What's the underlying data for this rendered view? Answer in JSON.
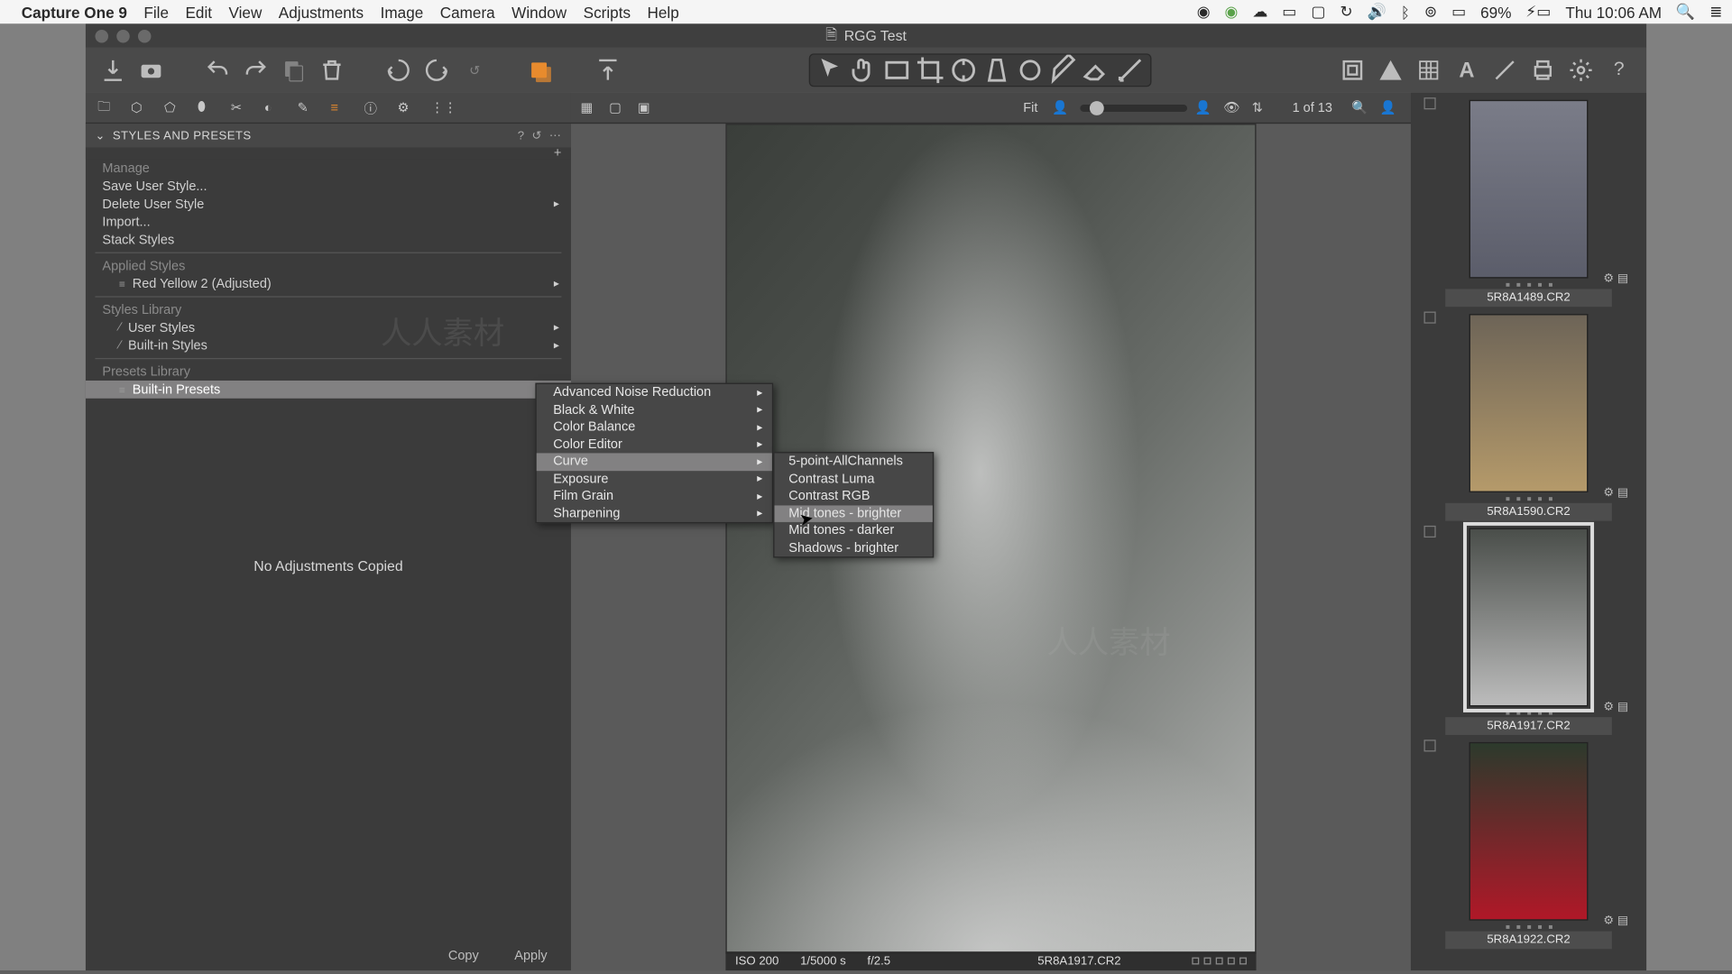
{
  "menubar": {
    "app": "Capture One 9",
    "items": [
      "File",
      "Edit",
      "View",
      "Adjustments",
      "Image",
      "Camera",
      "Window",
      "Scripts",
      "Help"
    ],
    "battery": "69%",
    "clock": "Thu 10:06 AM"
  },
  "window": {
    "title": "RGG Test"
  },
  "panel": {
    "title": "STYLES AND PRESETS",
    "manage": "Manage",
    "save_user_style": "Save User Style...",
    "delete_user_style": "Delete User Style",
    "import": "Import...",
    "stack_styles": "Stack Styles",
    "applied_styles": "Applied Styles",
    "applied_item": "Red Yellow 2 (Adjusted)",
    "styles_library": "Styles Library",
    "user_styles": "User Styles",
    "builtin_styles": "Built-in Styles",
    "presets_library": "Presets Library",
    "builtin_presets": "Built-in Presets",
    "no_adj": "No Adjustments Copied",
    "copy": "Copy",
    "apply": "Apply"
  },
  "flyout1": {
    "items": [
      "Advanced Noise Reduction",
      "Black & White",
      "Color Balance",
      "Color Editor",
      "Curve",
      "Exposure",
      "Film Grain",
      "Sharpening"
    ],
    "selected_index": 4
  },
  "flyout2": {
    "items": [
      "5-point-AllChannels",
      "Contrast Luma",
      "Contrast RGB",
      "Mid tones - brighter",
      "Mid tones - darker",
      "Shadows - brighter"
    ],
    "highlighted_index": 3
  },
  "viewer": {
    "fit": "Fit",
    "counter": "1 of 13",
    "iso": "ISO 200",
    "shutter": "1/5000 s",
    "aperture": "f/2.5",
    "filename": "5R8A1917.CR2"
  },
  "thumbs": [
    {
      "name": "5R8A1489.CR2",
      "sel": false,
      "grad": "linear-gradient(#7a7c88,#5b5d6a)"
    },
    {
      "name": "5R8A1590.CR2",
      "sel": false,
      "grad": "linear-gradient(#6d6457,#b59a6a)"
    },
    {
      "name": "5R8A1917.CR2",
      "sel": true,
      "grad": "linear-gradient(#4a4e4a,#bcbcbc)"
    },
    {
      "name": "5R8A1922.CR2",
      "sel": false,
      "grad": "linear-gradient(#2c3a2c,#b01828)"
    }
  ]
}
